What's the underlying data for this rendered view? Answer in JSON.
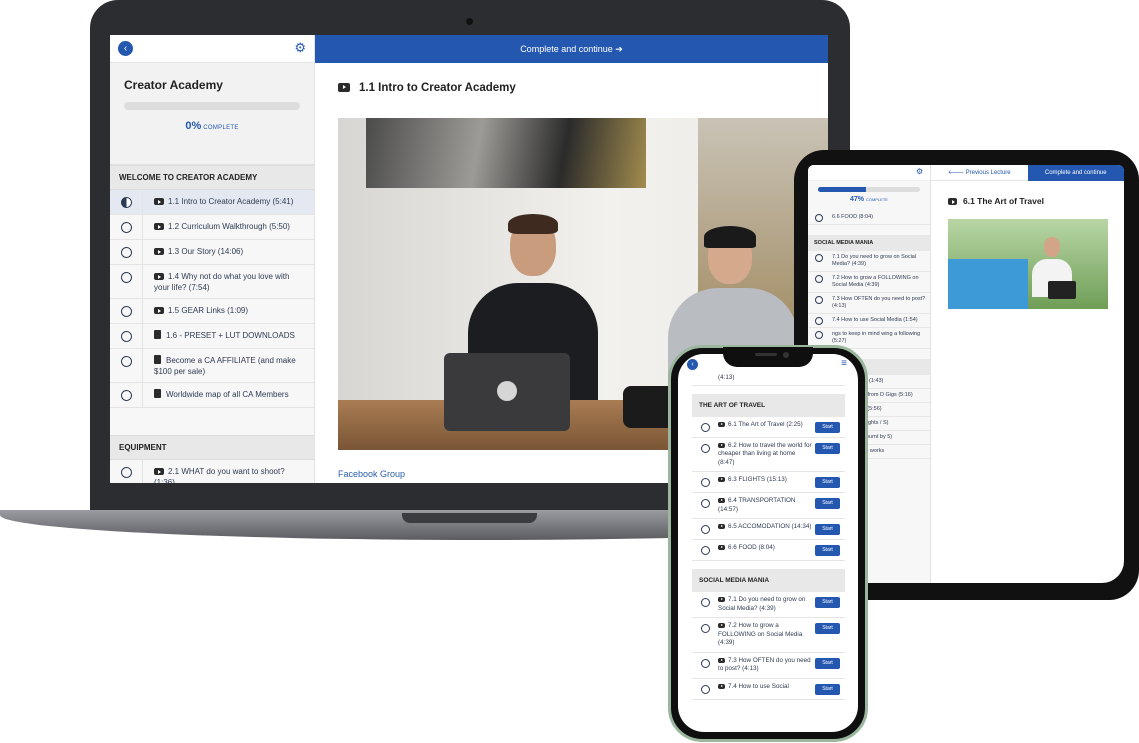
{
  "laptop": {
    "top_bar": "Complete and continue ➔",
    "course_title": "Creator Academy",
    "progress_percent": "0%",
    "progress_label": "COMPLETE",
    "progress_value": 0,
    "lecture_title": "1.1 Intro to Creator Academy",
    "link": "Facebook Group",
    "sections": [
      {
        "name": "WELCOME TO CREATOR ACADEMY",
        "lectures": [
          {
            "label": "1.1 Intro to Creator Academy (5:41)",
            "icon": "video-icon",
            "state": "half"
          },
          {
            "label": "1.2 Curriculum Walkthrough (5:50)",
            "icon": "video-icon",
            "state": "empty"
          },
          {
            "label": "1.3 Our Story (14:06)",
            "icon": "video-icon",
            "state": "empty"
          },
          {
            "label": "1.4 Why not do what you love with your life? (7:54)",
            "icon": "video-icon",
            "state": "empty"
          },
          {
            "label": "1.5 GEAR Links (1:09)",
            "icon": "video-icon",
            "state": "empty"
          },
          {
            "label": "1.6 - PRESET + LUT DOWNLOADS",
            "icon": "document-icon",
            "state": "empty"
          },
          {
            "label": "Become a CA AFFILIATE (and make $100 per sale)",
            "icon": "document-icon",
            "state": "empty"
          },
          {
            "label": "Worldwide map of all CA Members",
            "icon": "document-icon",
            "state": "empty"
          }
        ]
      },
      {
        "name": "EQUIPMENT",
        "lectures": [
          {
            "label": "2.1 WHAT do you want to shoot? (1:36)",
            "icon": "video-icon",
            "state": "empty"
          }
        ]
      }
    ]
  },
  "tablet": {
    "prev_label": "🡐 Previous Lecture",
    "next_label": "Complete and continue",
    "progress_percent": "47%",
    "progress_label": "COMPLETE",
    "progress_value": 0.47,
    "lecture_title": "6.1 The Art of Travel",
    "rows_top": [
      "6.6 FOOD (8:04)"
    ],
    "section1": "SOCIAL MEDIA MANIA",
    "rows1": [
      "7.1 Do you need to grow on Social Media? (4:39)",
      "7.2 How to grow a FOLLOWING on Social Media (4:39)",
      "7.3 How OFTEN do you need to post? (4:13)",
      "7.4 How to use Social Media (1:54)",
      "ngs to keep in mind wing a following (5:27)"
    ],
    "section2": "RSIFYING INCOME",
    "rows2": [
      "D to Paid Gigs (1:43)",
      "w to transition from D Gigs (5:16)",
      "TES EMAIL S (5:56)",
      "ting PAID in Flights / S)",
      "w to NOT get burnt by 5)",
      "r the exchange works"
    ]
  },
  "phone": {
    "cut_top": "(4:13)",
    "start_label": "Start",
    "section1": "THE ART OF TRAVEL",
    "rows1": [
      "6.1 The Art of Travel (2:25)",
      "6.2 How to travel the world for cheaper than living at home (8:47)",
      "6.3 FLIGHTS (15:13)",
      "6.4 TRANSPORTATION (14:57)",
      "6.5 ACCOMODATION (14:34)",
      "6.6 FOOD (8:04)"
    ],
    "section2": "SOCIAL MEDIA MANIA",
    "rows2": [
      "7.1 Do you need to grow on Social Media? (4:39)",
      "7.2 How to grow a FOLLOWING on Social Media (4:39)",
      "7.3 How OFTEN do you need to post? (4:13)",
      "7.4 How to use Social"
    ]
  },
  "colors": {
    "accent": "#2457b0",
    "text": "#2f3b52"
  }
}
